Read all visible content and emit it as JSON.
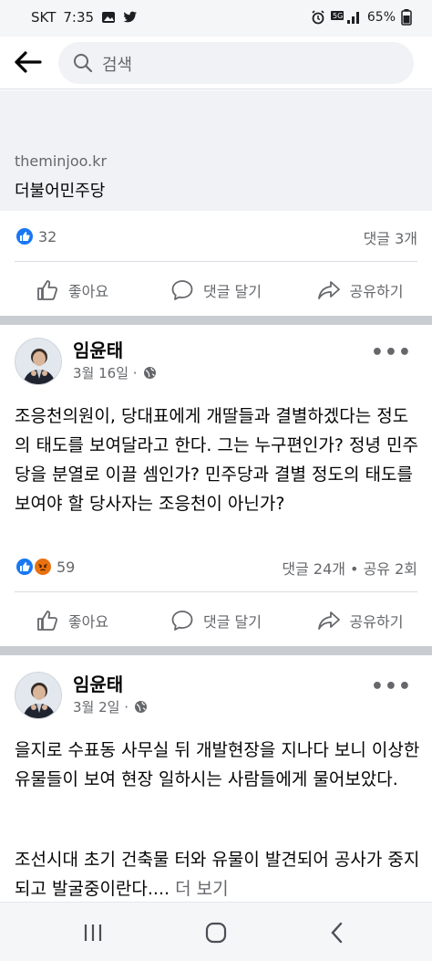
{
  "status_bar": {
    "carrier": "SKT",
    "time": "7:35",
    "battery": "65%"
  },
  "search": {
    "placeholder": "검색"
  },
  "shared_link": {
    "domain": "theminjoo.kr",
    "title": "더불어민주당"
  },
  "post0_stats": {
    "reactions": "32",
    "comments": "댓글 3개"
  },
  "actions": {
    "like": "좋아요",
    "comment": "댓글 달기",
    "share": "공유하기"
  },
  "post1": {
    "author": "임윤태",
    "date": "3월 16일 ·",
    "text": "조응천의원이, 당대표에게 개딸들과 결별하겠다는 정도의 태도를 보여달라고 한다. 그는 누구편인가? 정녕 민주당을 분열로 이끌 셈인가? 민주당과 결별 정도의 태도를 보여야 할 당사자는 조응천이 아닌가?",
    "reactions": "59",
    "stats": "댓글 24개 • 공유 2회"
  },
  "post2": {
    "author": "임윤태",
    "date": "3월 2일 ·",
    "text1": "을지로 수표동 사무실 뒤 개발현장을 지나다 보니 이상한 유물들이 보여 현장 일하시는 사람들에게 물어보았다.",
    "text2": "조선시대 초기 건축물 터와 유물이 발견되어 공사가 중지되고 발굴중이란다....",
    "see_more": "더 보기"
  },
  "icons": {
    "back": "arrow-left-icon",
    "search": "magnifier-icon",
    "like": "thumbs-up-icon",
    "comment": "speech-bubble-icon",
    "share": "share-arrow-icon",
    "globe": "globe-icon",
    "more": "more-dots-icon"
  },
  "colors": {
    "accent": "#1877f2",
    "angry": "#e9710f",
    "meta": "#65676b",
    "separator": "#c9ccd1"
  }
}
